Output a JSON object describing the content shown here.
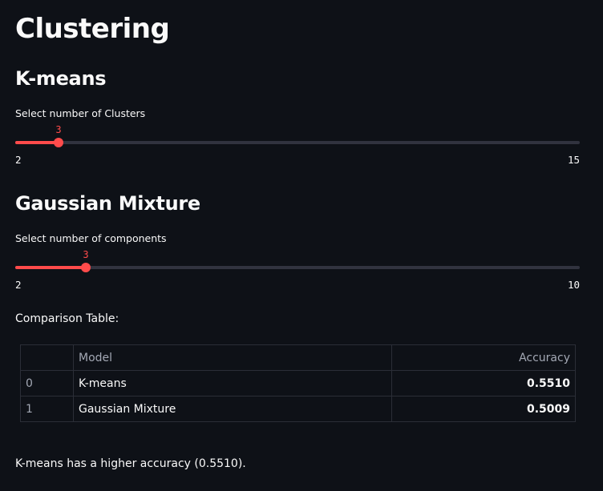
{
  "title": "Clustering",
  "kmeans": {
    "header": "K-means",
    "slider": {
      "label": "Select number of Clusters",
      "value": "3",
      "min": "2",
      "max": "15",
      "fraction": 0.077
    }
  },
  "gmm": {
    "header": "Gaussian Mixture",
    "slider": {
      "label": "Select number of components",
      "value": "3",
      "min": "2",
      "max": "10",
      "fraction": 0.125
    }
  },
  "comparison": {
    "caption": "Comparison Table:",
    "columns": [
      "",
      "Model",
      "Accuracy"
    ],
    "rows": [
      {
        "index": "0",
        "model": "K-means",
        "accuracy": "0.5510"
      },
      {
        "index": "1",
        "model": "Gaussian Mixture",
        "accuracy": "0.5009"
      }
    ]
  },
  "result_text": "K-means has a higher accuracy (0.5510).",
  "colors": {
    "background": "#0e1117",
    "accent": "#ff4b4b",
    "track": "#31333f"
  }
}
